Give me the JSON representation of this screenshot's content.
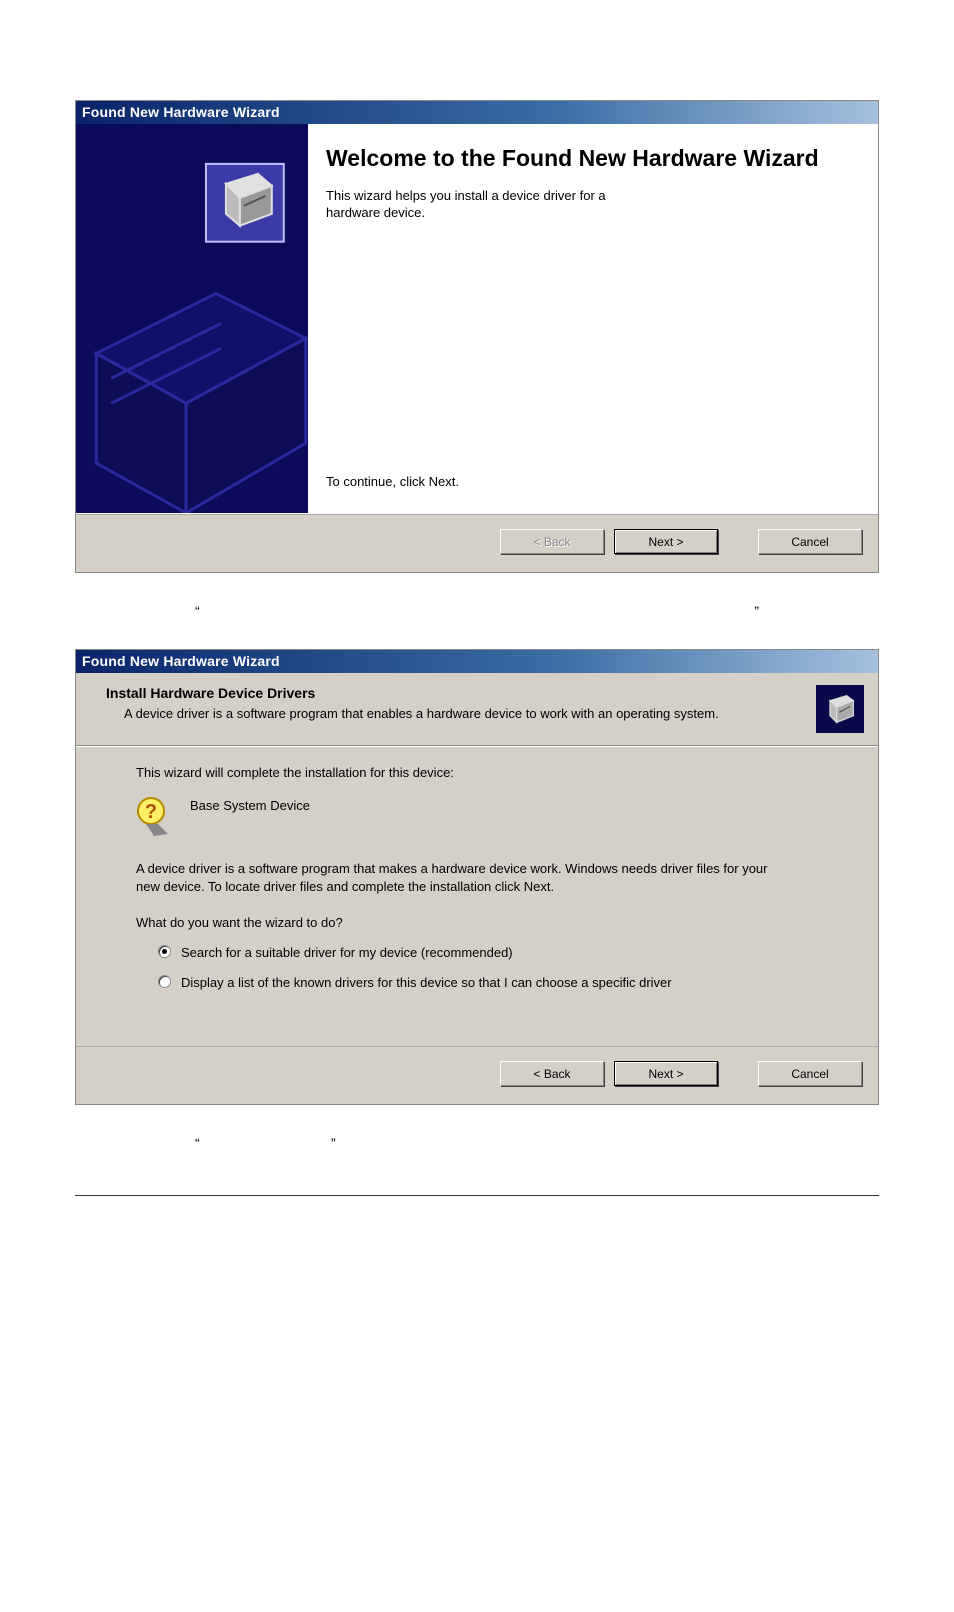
{
  "dialog1": {
    "title": "Found New Hardware Wizard",
    "heading": "Welcome to the Found New Hardware Wizard",
    "subtext": "This wizard helps you install a device driver for a hardware device.",
    "continue": "To continue, click Next.",
    "buttons": {
      "back": "< Back",
      "next": "Next >",
      "cancel": "Cancel"
    }
  },
  "quotes1": {
    "left": "“",
    "right": "”"
  },
  "dialog2": {
    "title": "Found New Hardware Wizard",
    "header_title": "Install Hardware Device Drivers",
    "header_sub": "A device driver is a software program that enables a hardware device to work with an operating system.",
    "intro": "This wizard will complete the installation for this device:",
    "device_name": "Base System Device",
    "paragraph": "A device driver is a software program that makes a hardware device work. Windows needs driver files for your new device. To locate driver files and complete the installation click Next.",
    "question": "What do you want the wizard to do?",
    "options": {
      "search": "Search for a suitable driver for my device (recommended)",
      "list": "Display a list of the known drivers for this device so that I can choose a specific driver"
    },
    "buttons": {
      "back": "< Back",
      "next": "Next >",
      "cancel": "Cancel"
    }
  },
  "quotes2": {
    "left": "“",
    "right": "”"
  }
}
